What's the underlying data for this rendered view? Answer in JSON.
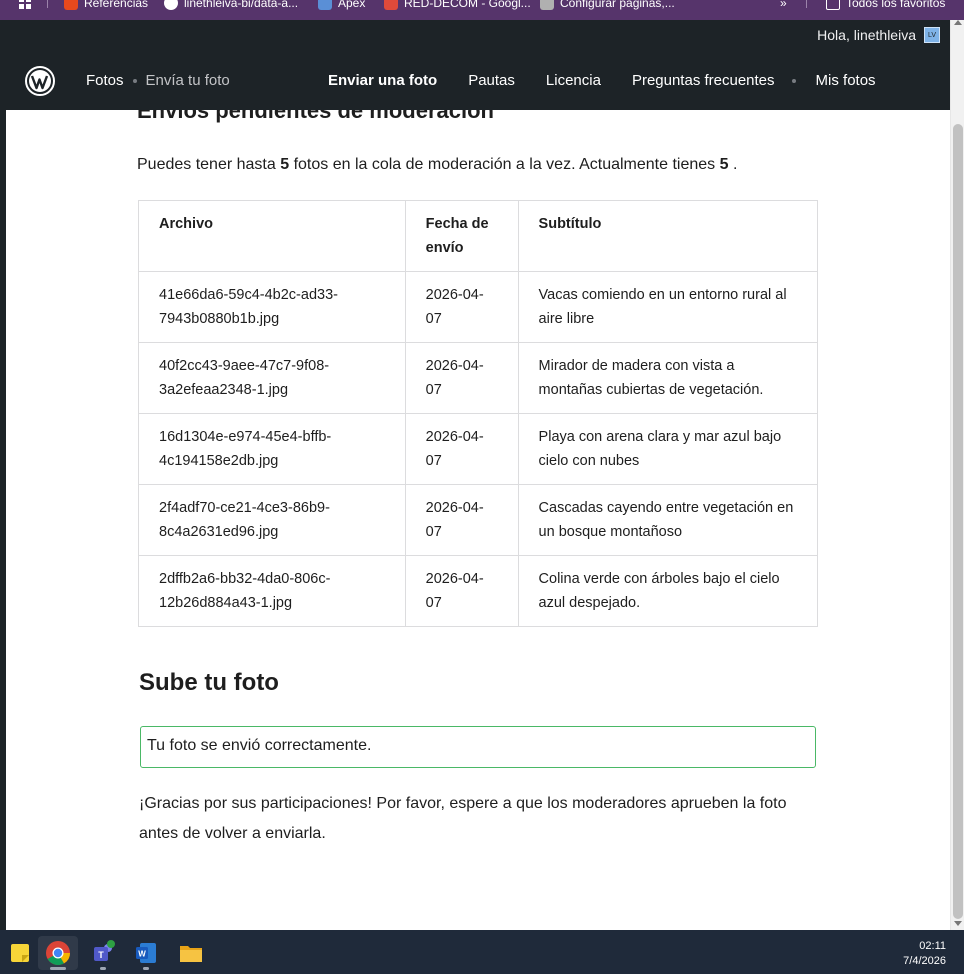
{
  "bookmarks": [
    {
      "label": "Referencias",
      "color": "#e8491d"
    },
    {
      "label": "linethleiva-bi/data-a...",
      "color": "#ffffff"
    },
    {
      "label": "Apex",
      "color": "#5a8fd6"
    },
    {
      "label": "RED-DECOM - Googl...",
      "color": "#e04a3a"
    },
    {
      "label": "Configurar páginas,...",
      "color": "#b0b0b0"
    },
    {
      "label": "Todos los favoritos",
      "color": "#ffffff"
    }
  ],
  "adminbar": {
    "greeting": "Hola, linethleiva",
    "avatar_initials": "LV"
  },
  "nav": {
    "breadcrumb": [
      "Fotos",
      "Envía tu foto"
    ],
    "menu": [
      "Enviar una foto",
      "Pautas",
      "Licencia",
      "Preguntas frecuentes",
      "Mis fotos"
    ],
    "active_index": 0
  },
  "pending": {
    "heading": "Envíos pendientes de moderación",
    "intro_before": "Puedes tener hasta ",
    "max_count": "5",
    "intro_middle": " fotos en la cola de moderación a la vez. Actualmente tienes ",
    "current_count": "5",
    "intro_after": " .",
    "columns": [
      "Archivo",
      "Fecha de envío",
      "Subtítulo"
    ],
    "rows": [
      {
        "file": "41e66da6-59c4-4b2c-ad33-7943b0880b1b.jpg",
        "date": "2026-04-07",
        "caption": "Vacas comiendo en un entorno rural al aire libre"
      },
      {
        "file": "40f2cc43-9aee-47c7-9f08-3a2efeaa2348-1.jpg",
        "date": "2026-04-07",
        "caption": "Mirador de madera con vista a montañas cubiertas de vegetación."
      },
      {
        "file": "16d1304e-e974-45e4-bffb-4c194158e2db.jpg",
        "date": "2026-04-07",
        "caption": "Playa con arena clara y mar azul bajo cielo con nubes"
      },
      {
        "file": "2f4adf70-ce21-4ce3-86b9-8c4a2631ed96.jpg",
        "date": "2026-04-07",
        "caption": "Cascadas cayendo entre vegetación en un bosque montañoso"
      },
      {
        "file": "2dffb2a6-bb32-4da0-806c-12b26d884a43-1.jpg",
        "date": "2026-04-07",
        "caption": "Colina verde con árboles bajo el cielo azul despejado."
      }
    ]
  },
  "upload": {
    "heading": "Sube tu foto",
    "success_notice": "Tu foto se envió correctamente.",
    "thanks": "¡Gracias por sus participaciones! Por favor, espere a que los moderadores aprueben la foto antes de volver a enviarla."
  },
  "taskbar": {
    "apps": [
      "sticky-notes",
      "chrome",
      "teams",
      "word",
      "file-explorer"
    ],
    "time": "02:11",
    "date": "7/4/2026"
  },
  "colors": {
    "wp_dark": "#1d2327",
    "success_border": "#4ab866",
    "browser_frame": "#56346b",
    "taskbar": "#1f2a3a"
  }
}
